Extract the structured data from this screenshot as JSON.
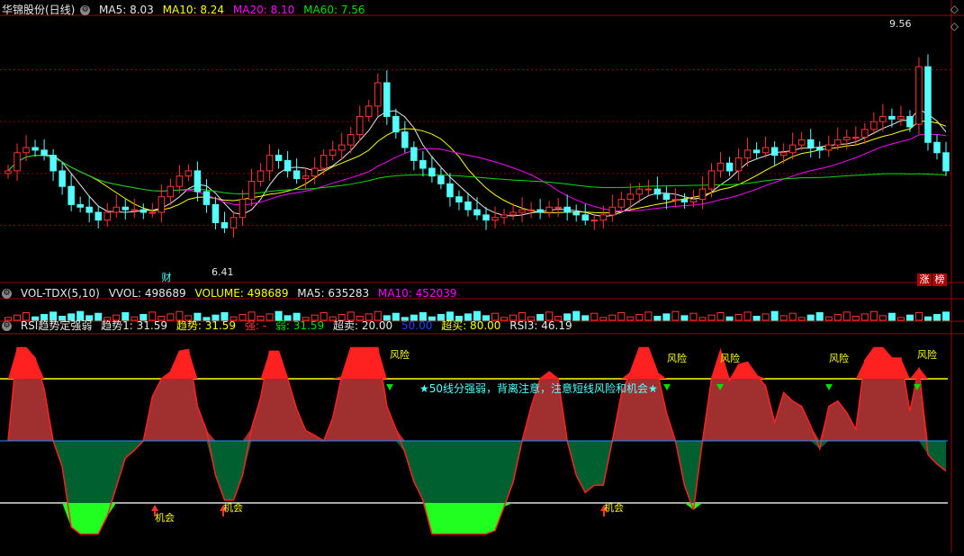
{
  "colors": {
    "up": "#ff3232",
    "down": "#54ffff",
    "ma5": "#e8e8e8",
    "ma10": "#ffff00",
    "ma20": "#ff00ff",
    "ma60": "#00e000",
    "grid": "#8b0000",
    "sep": "#a00000"
  },
  "price_panel": {
    "title": "华锦股份(日线)",
    "ma5": "MA5: 8.03",
    "ma10": "MA10: 8.24",
    "ma20": "MA20: 8.10",
    "ma60": "MA60: 7.56",
    "high_label": "9.56",
    "low_label": "6.41",
    "cai_label": "财",
    "zhang_label": "涨",
    "bang_label": "榜"
  },
  "volume_panel": {
    "name": "VOL-TDX(5,10)",
    "vvol": "VVOL: 498689",
    "volume": "VOLUME: 498689",
    "ma5": "MA5: 635283",
    "ma10": "MA10: 452039"
  },
  "rsi_panel": {
    "name": "RSI趋势定强弱",
    "trend1": "趋势1: 31.59",
    "trend": "趋势: 31.59",
    "strong": "强: -",
    "weak": "弱: 31.59",
    "oversold": "超卖: 20.00",
    "level50": "50.00",
    "overbought": "超买: 80.00",
    "rsi3": "RSI3: 46.19",
    "note": "★50线分强弱，背离注意，注意短线风险和机会★",
    "risk_label": "风险",
    "opportunity_label": "机会"
  },
  "chart_data": [
    {
      "type": "candlestick",
      "title": "华锦股份(日线)",
      "ylim": [
        5.5,
        10.5
      ],
      "high": 9.56,
      "low": 6.41,
      "ma": {
        "MA5": 8.03,
        "MA10": 8.24,
        "MA20": 8.1,
        "MA60": 7.56
      },
      "close": [
        7.55,
        7.9,
        8.0,
        7.95,
        7.85,
        7.55,
        7.25,
        6.9,
        6.85,
        6.75,
        6.6,
        6.75,
        6.85,
        6.8,
        6.8,
        6.75,
        6.75,
        7.05,
        7.25,
        7.45,
        7.55,
        7.15,
        6.9,
        6.55,
        6.45,
        6.65,
        7.0,
        7.35,
        7.55,
        7.85,
        7.75,
        7.55,
        7.4,
        7.45,
        7.6,
        7.85,
        7.95,
        8.05,
        8.25,
        8.6,
        8.8,
        9.25,
        8.6,
        8.3,
        8.0,
        7.75,
        7.6,
        7.45,
        7.3,
        7.05,
        6.95,
        6.8,
        6.7,
        6.6,
        6.65,
        6.7,
        6.75,
        6.8,
        6.8,
        6.75,
        6.85,
        6.85,
        6.75,
        6.7,
        6.6,
        6.6,
        6.7,
        6.85,
        7.0,
        7.1,
        7.2,
        7.2,
        7.1,
        7.0,
        7.0,
        6.95,
        7.0,
        7.2,
        7.55,
        7.7,
        7.55,
        7.8,
        7.95,
        7.9,
        8.0,
        7.85,
        7.9,
        8.05,
        8.15,
        8.0,
        7.95,
        8.05,
        8.15,
        8.2,
        8.2,
        8.35,
        8.5,
        8.6,
        8.55,
        8.6,
        8.4,
        9.56,
        8.1,
        7.9,
        7.55
      ]
    },
    {
      "type": "bar",
      "title": "VOL-TDX(5,10)",
      "VVOL": 498689,
      "VOLUME": 498689,
      "MA5": 635283,
      "MA10": 452039
    },
    {
      "type": "area",
      "title": "RSI趋势定强弱",
      "ylim": [
        0,
        100
      ],
      "levels": {
        "oversold": 20.0,
        "middle": 50.0,
        "overbought": 80.0
      },
      "values": {
        "趋势1": 31.59,
        "趋势": 31.59,
        "强": "-",
        "弱": 31.59,
        "RSI3": 46.19
      }
    }
  ]
}
